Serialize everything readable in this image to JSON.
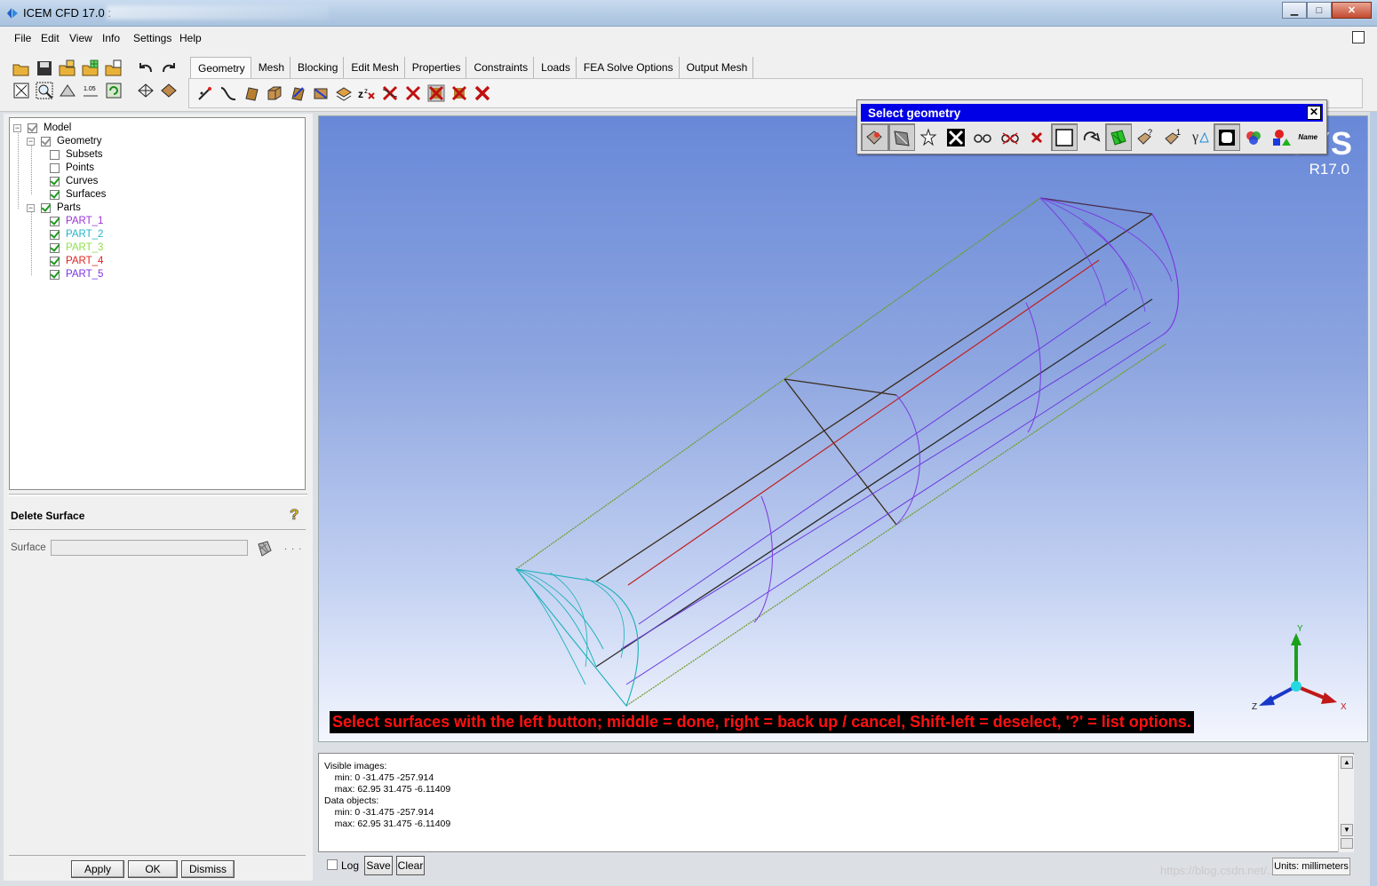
{
  "window": {
    "title": "ICEM CFD 17.0 :"
  },
  "menu": [
    "File",
    "Edit",
    "View",
    "Info",
    "Settings",
    "Help"
  ],
  "tabs": [
    "Geometry",
    "Mesh",
    "Blocking",
    "Edit Mesh",
    "Properties",
    "Constraints",
    "Loads",
    "FEA Solve Options",
    "Output Mesh"
  ],
  "active_tab": "Geometry",
  "tree": {
    "model": "Model",
    "geometry": "Geometry",
    "subsets": "Subsets",
    "points": "Points",
    "curves": "Curves",
    "surfaces": "Surfaces",
    "parts": "Parts",
    "part_items": [
      {
        "name": "PART_1",
        "color": "#9a33d8"
      },
      {
        "name": "PART_2",
        "color": "#21b5c8"
      },
      {
        "name": "PART_3",
        "color": "#8ee04a"
      },
      {
        "name": "PART_4",
        "color": "#e0221f"
      },
      {
        "name": "PART_5",
        "color": "#7b33e8"
      }
    ]
  },
  "form": {
    "title": "Delete Surface",
    "surface_label": "Surface",
    "surface_value": "",
    "more": ". . .",
    "apply": "Apply",
    "ok": "OK",
    "dismiss": "Dismiss"
  },
  "select_popup": {
    "title": "Select geometry",
    "close": "✕",
    "tools": [
      "select-by-window-icon",
      "select-all-visible-icon",
      "toggle-selection-icon",
      "select-all-icon",
      "select-visible-icon",
      "deselect-all-icon",
      "cancel-icon",
      "rectangle-select-icon",
      "circle-select-icon",
      "polygon-select-icon",
      "select-by-dimension-icon",
      "select-by-type-icon",
      "select-by-curvature-icon",
      "select-by-subset-icon",
      "select-by-color-icon",
      "select-by-part-icon",
      "select-by-name-icon"
    ],
    "name_label": "Name"
  },
  "viewport": {
    "brand": "ANSYS",
    "version": "R17.0",
    "status": "Select surfaces with the left button; middle = done, right = back up / cancel, Shift-left = deselect, '?' = list options.",
    "axes": {
      "y": "Y",
      "x": "X",
      "z": "Z"
    }
  },
  "messages": "Visible images:\n    min: 0 -31.475 -257.914\n    max: 62.95 31.475 -6.11409\nData objects:\n    min: 0 -31.475 -257.914\n    max: 62.95 31.475 -6.11409",
  "bottom": {
    "log": "Log",
    "save": "Save",
    "clear": "Clear",
    "units": "Units: millimeters",
    "watermark": "https://blog.csdn.net/..."
  }
}
